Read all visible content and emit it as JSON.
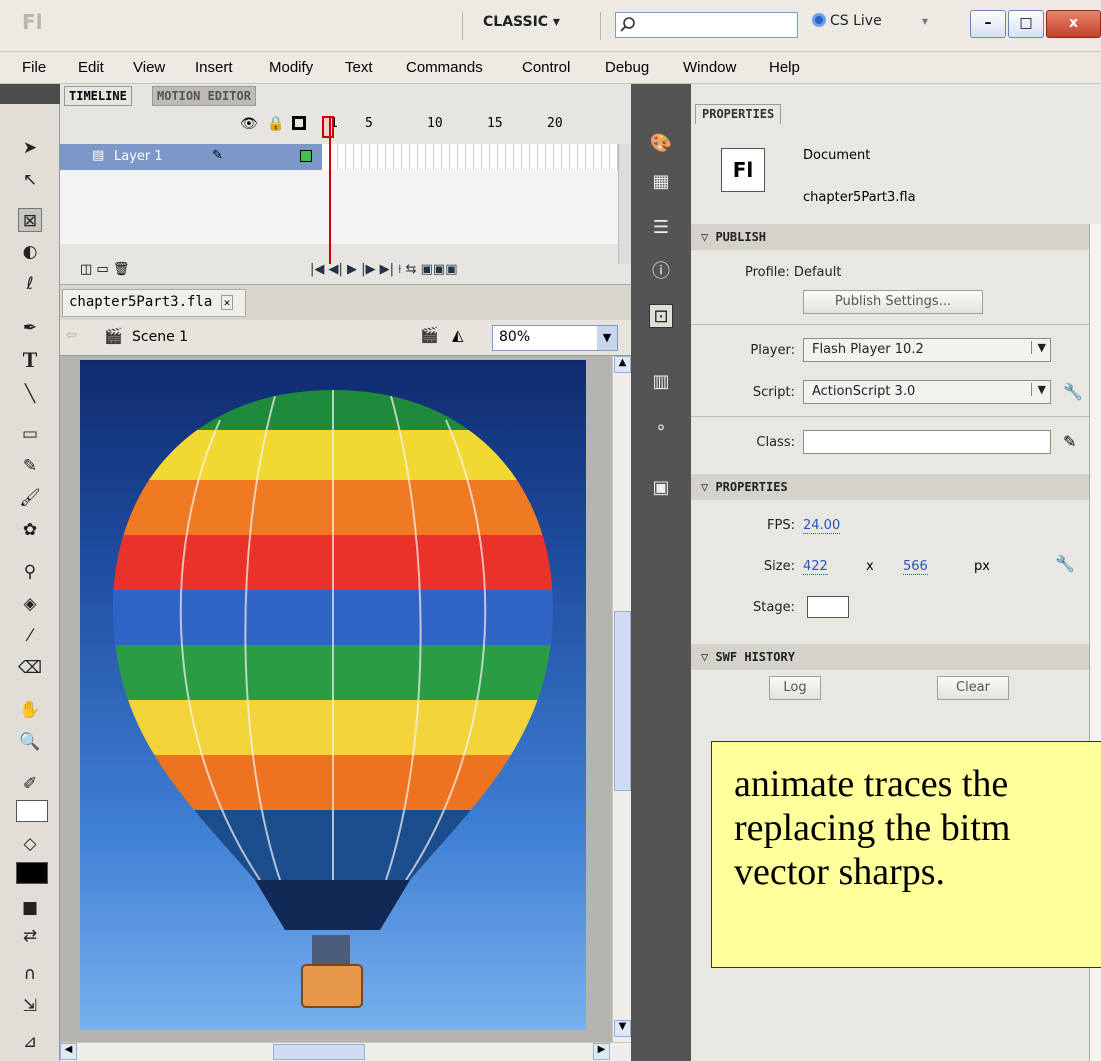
{
  "window": {
    "logo": "Fl",
    "workspace": "CLASSIC ▾",
    "search_placeholder": "",
    "cslive": "CS Live",
    "controls": [
      "–",
      "□",
      "x"
    ]
  },
  "menu": [
    "File",
    "Edit",
    "View",
    "Insert",
    "Modify",
    "Text",
    "Commands",
    "Control",
    "Debug",
    "Window",
    "Help"
  ],
  "timeline": {
    "tabs": [
      "TIMELINE",
      "MOTION EDITOR"
    ],
    "layer": "Layer 1",
    "ruler": [
      "1",
      "5",
      "10",
      "15",
      "20"
    ]
  },
  "document": {
    "tab": "chapter5Part3.fla",
    "scene": "Scene 1",
    "zoom": "80%"
  },
  "properties": {
    "tab": "PROPERTIES",
    "doc_type": "Document",
    "doc_name": "chapter5Part3.fla",
    "doc_icon": "Fl",
    "publish": {
      "header": "PUBLISH",
      "profile": "Profile: Default",
      "settings_button": "Publish Settings...",
      "player_label": "Player:",
      "player": "Flash Player 10.2",
      "script_label": "Script:",
      "script": "ActionScript 3.0",
      "class_label": "Class:"
    },
    "props": {
      "header": "PROPERTIES",
      "fps_label": "FPS:",
      "fps": "24.00",
      "size_label": "Size:",
      "width": "422",
      "x": "x",
      "height": "566",
      "unit": "px",
      "stage_label": "Stage:"
    },
    "swf": {
      "header": "SWF HISTORY",
      "log": "Log",
      "clear": "Clear"
    }
  },
  "callout": "animate traces the replacing the bitm vector sharps."
}
